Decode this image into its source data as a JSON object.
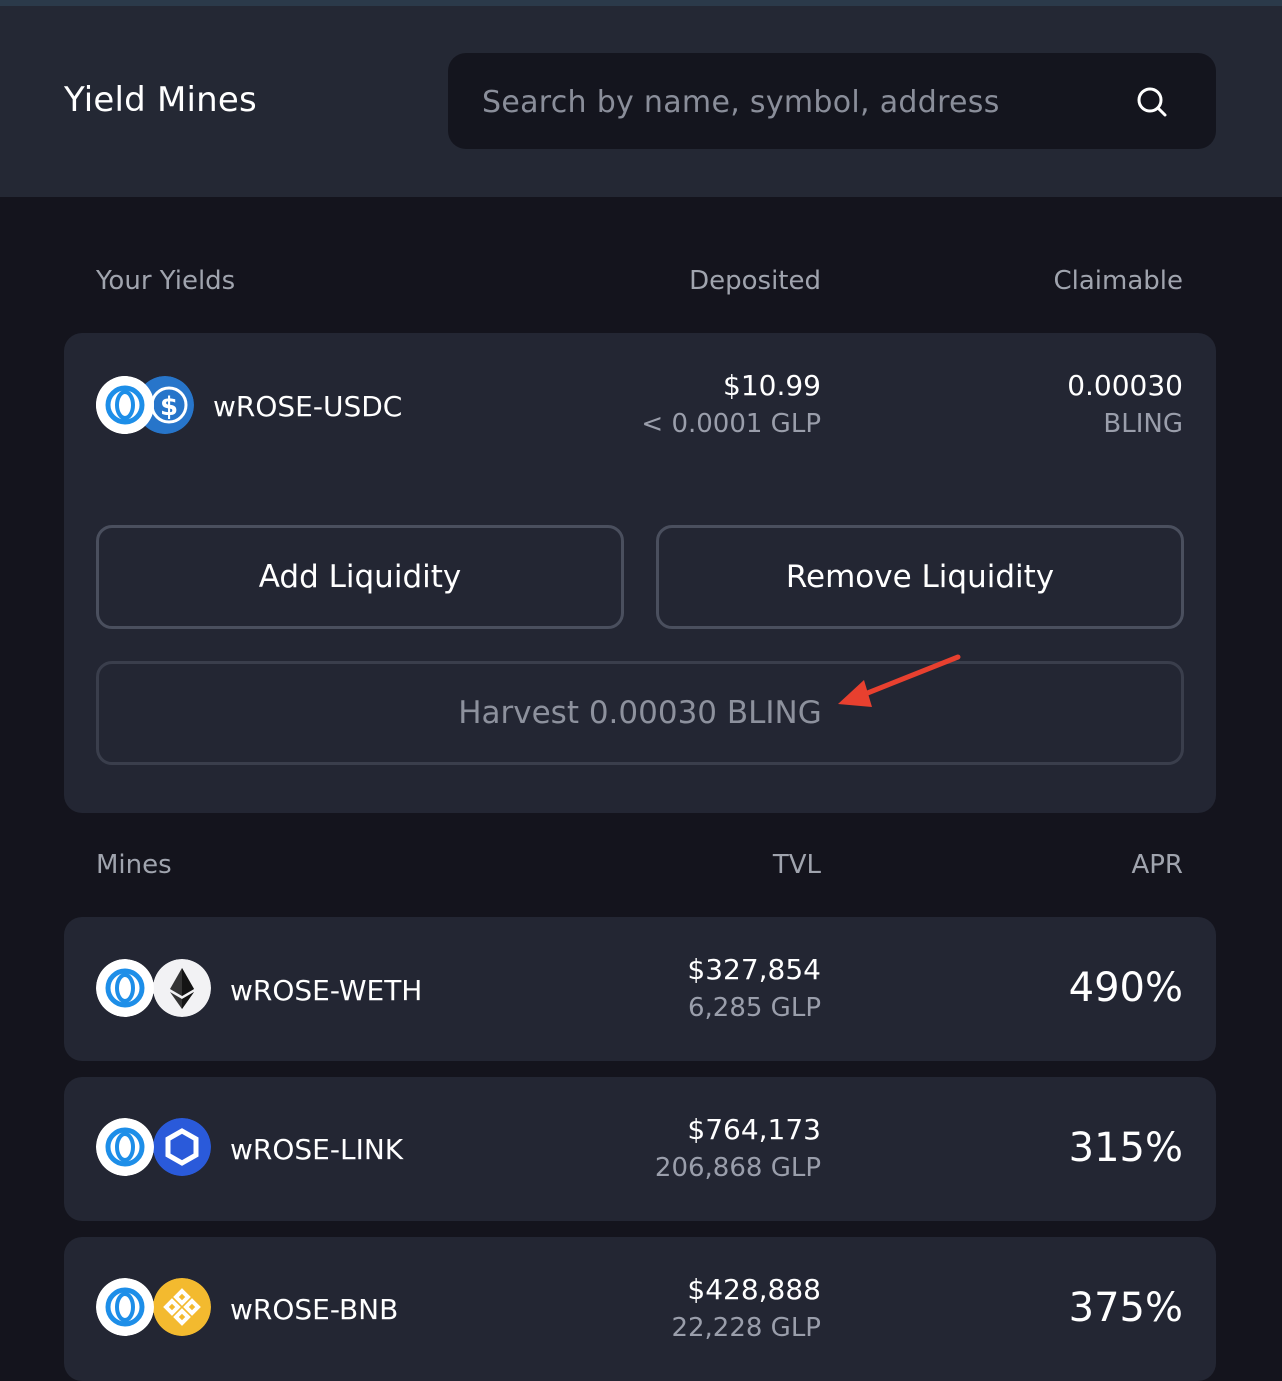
{
  "header": {
    "title": "Yield Mines",
    "search_placeholder": "Search by name, symbol, address"
  },
  "your_yields": {
    "col_name": "Your Yields",
    "col_deposited": "Deposited",
    "col_claimable": "Claimable",
    "position": {
      "pair": "wROSE-USDC",
      "token_icons": [
        "oasis-rose-icon",
        "usdc-icon"
      ],
      "deposited_usd": "$10.99",
      "deposited_glp": "< 0.0001 GLP",
      "claimable_amount": "0.00030",
      "claimable_token": "BLING"
    },
    "add_liquidity_label": "Add Liquidity",
    "remove_liquidity_label": "Remove Liquidity",
    "harvest_label": "Harvest 0.00030 BLING"
  },
  "mines": {
    "col_name": "Mines",
    "col_tvl": "TVL",
    "col_apr": "APR",
    "rows": [
      {
        "pair": "wROSE-WETH",
        "token_icons": [
          "oasis-rose-icon",
          "ethereum-icon"
        ],
        "tvl_usd": "$327,854",
        "tvl_glp": "6,285 GLP",
        "apr": "490%"
      },
      {
        "pair": "wROSE-LINK",
        "token_icons": [
          "oasis-rose-icon",
          "chainlink-icon"
        ],
        "tvl_usd": "$764,173",
        "tvl_glp": "206,868 GLP",
        "apr": "315%"
      },
      {
        "pair": "wROSE-BNB",
        "token_icons": [
          "oasis-rose-icon",
          "bnb-icon"
        ],
        "tvl_usd": "$428,888",
        "tvl_glp": "22,228 GLP",
        "apr": "375%"
      }
    ]
  },
  "colors": {
    "background": "#14141d",
    "header_bg": "#242834",
    "card_bg": "#232633",
    "muted_text": "#9a9eab",
    "annotation_arrow": "#e8402f"
  }
}
